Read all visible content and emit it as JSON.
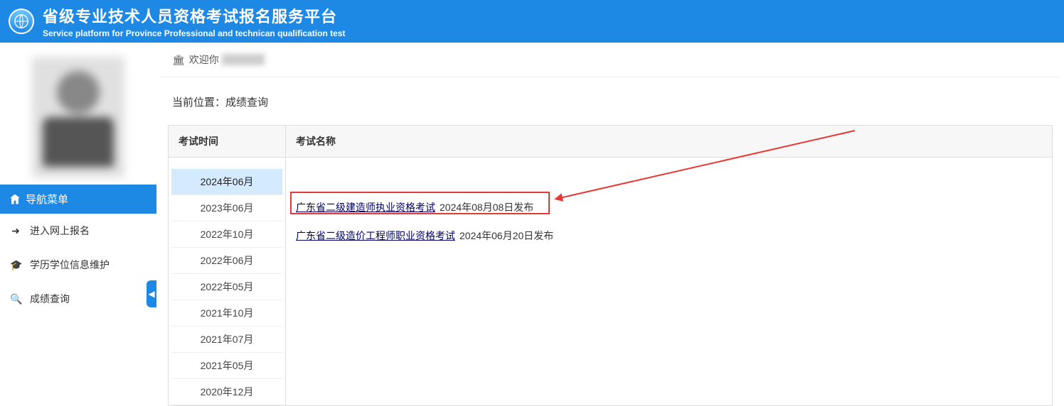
{
  "header": {
    "title": "省级专业技术人员资格考试报名服务平台",
    "subtitle": "Service platform for Province Professional and technican qualification test"
  },
  "sidebar": {
    "nav_head": "导航菜单",
    "items": [
      {
        "icon": "➜",
        "label": "进入网上报名"
      },
      {
        "icon": "🎓",
        "label": "学历学位信息维护"
      },
      {
        "icon": "🔍",
        "label": "成绩查询"
      }
    ],
    "collapse_glyph": "◀"
  },
  "welcome": {
    "icon": "🏛",
    "text": "欢迎你"
  },
  "breadcrumb": {
    "prefix": "当前位置：",
    "current": "成绩查询"
  },
  "table": {
    "time_header": "考试时间",
    "name_header": "考试名称",
    "times": [
      {
        "label": "2024年06月",
        "active": true
      },
      {
        "label": "2023年06月",
        "active": false
      },
      {
        "label": "2022年10月",
        "active": false
      },
      {
        "label": "2022年06月",
        "active": false
      },
      {
        "label": "2022年05月",
        "active": false
      },
      {
        "label": "2021年10月",
        "active": false
      },
      {
        "label": "2021年07月",
        "active": false
      },
      {
        "label": "2021年05月",
        "active": false
      },
      {
        "label": "2020年12月",
        "active": false
      }
    ],
    "exams": [
      {
        "name": "广东省二级建造师执业资格考试",
        "date": "2024年08月08日发布",
        "highlight": true
      },
      {
        "name": "广东省二级造价工程师职业资格考试",
        "date": "2024年06月20日发布",
        "highlight": false
      }
    ]
  }
}
